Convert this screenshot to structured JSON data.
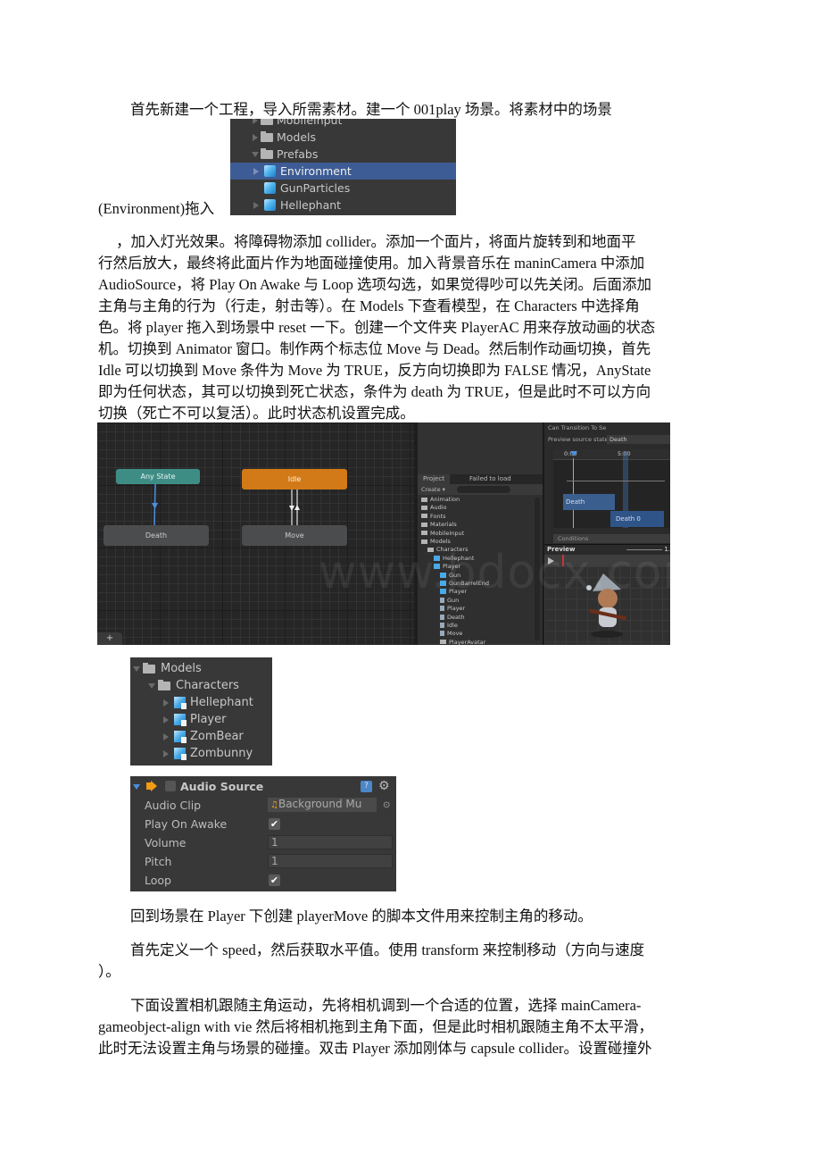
{
  "paragraphs": {
    "p1_line1": "首先新建一个工程，导入所需素材。建一个 001play 场景。将素材中的场景",
    "p1_line2_prefix": "(Environment)拖入",
    "p2_lines": [
      "，加入灯光效果。将障碍物添加 collider。添加一个面片，将面片旋转到和地面平",
      "行然后放大，最终将此面片作为地面碰撞使用。加入背景音乐在 maninCamera 中添加",
      "AudioSource，将 Play On Awake 与 Loop 选项勾选，如果觉得吵可以先关闭。后面添加",
      "主角与主角的行为（行走，射击等）。在 Models 下查看模型，在 Characters 中选择角",
      "色。将 player 拖入到场景中 reset 一下。创建一个文件夹 PlayerAC 用来存放动画的状态",
      "机。切换到 Animator 窗口。制作两个标志位 Move 与 Dead。然后制作动画切换，首先",
      "Idle 可以切换到 Move 条件为 Move 为 TRUE，反方向切换即为 FALSE 情况，AnyState",
      "即为任何状态，其可以切换到死亡状态，条件为 death 为 TRUE，但是此时不可以方向",
      "切换（死亡不可以复活）。此时状态机设置完成。"
    ],
    "p3": "回到场景在 Player 下创建 playerMove 的脚本文件用来控制主角的移动。",
    "p4_lines": [
      "首先定义一个 speed，然后获取水平值。使用 transform 来控制移动（方向与速度",
      "）。"
    ],
    "p5_lines": [
      "下面设置相机跟随主角运动，先将相机调到一个合适的位置，选择 mainCamera-",
      "gameobject-align with vie 然后将相机拖到主角下面，但是此时相机跟随主角不太平滑，",
      "此时无法设置主角与场景的碰撞。双击 Player 添加刚体与 capsule collider。设置碰撞外"
    ]
  },
  "prefabs_panel": {
    "items": [
      {
        "label": "MobileInput",
        "type": "folder",
        "expanded": false
      },
      {
        "label": "Models",
        "type": "folder",
        "expanded": false
      },
      {
        "label": "Prefabs",
        "type": "folder",
        "expanded": true
      },
      {
        "label": "Environment",
        "type": "prefab",
        "selected": true,
        "has_children": true
      },
      {
        "label": "GunParticles",
        "type": "prefab",
        "has_children": false
      },
      {
        "label": "Hellephant",
        "type": "prefab",
        "has_children": true
      }
    ]
  },
  "animator": {
    "states": {
      "any_state": "Any State",
      "idle": "Idle",
      "death": "Death",
      "move": "Move"
    },
    "add_button": "+",
    "watermark": "www.bdocx.com",
    "colors": {
      "any_state": "#3e8d85",
      "idle": "#d27a17",
      "default": "#4b4c4e",
      "transition": "#4a90e2"
    },
    "project": {
      "tabs": [
        "Project",
        "Failed to load"
      ],
      "create_label": "Create ▾",
      "items": [
        {
          "label": "Animation",
          "depth": 0,
          "type": "folder"
        },
        {
          "label": "Audio",
          "depth": 0,
          "type": "folder"
        },
        {
          "label": "Fonts",
          "depth": 0,
          "type": "folder"
        },
        {
          "label": "Materials",
          "depth": 0,
          "type": "folder"
        },
        {
          "label": "MobileInput",
          "depth": 0,
          "type": "folder"
        },
        {
          "label": "Models",
          "depth": 0,
          "type": "folder"
        },
        {
          "label": "Characters",
          "depth": 1,
          "type": "folder"
        },
        {
          "label": "Hellephant",
          "depth": 2,
          "type": "model"
        },
        {
          "label": "Player",
          "depth": 2,
          "type": "model"
        },
        {
          "label": "Gun",
          "depth": 3,
          "type": "model"
        },
        {
          "label": "GunBarrelEnd",
          "depth": 3,
          "type": "model"
        },
        {
          "label": "Player",
          "depth": 3,
          "type": "model"
        },
        {
          "label": "Gun",
          "depth": 3,
          "type": "mesh"
        },
        {
          "label": "Player",
          "depth": 3,
          "type": "mesh"
        },
        {
          "label": "Death",
          "depth": 3,
          "type": "anim"
        },
        {
          "label": "Idle",
          "depth": 3,
          "type": "anim"
        },
        {
          "label": "Move",
          "depth": 3,
          "type": "anim"
        },
        {
          "label": "PlayerAvatar",
          "depth": 3,
          "type": "avatar"
        }
      ]
    },
    "inspector": {
      "can_transition_label": "Can Transition To Se",
      "preview_source_label": "Preview source state",
      "preview_source_value": "Death",
      "timeline_start": "0:00",
      "timeline_end": "5:00",
      "bar_death": "Death",
      "bar_death0": "Death 0",
      "conditions_label": "Conditions",
      "preview_label": "Preview",
      "speed_value": "1."
    }
  },
  "models_panel": {
    "items": [
      {
        "label": "Models",
        "type": "folder",
        "depth": 0
      },
      {
        "label": "Characters",
        "type": "folder",
        "depth": 1
      },
      {
        "label": "Hellephant",
        "type": "model",
        "depth": 2
      },
      {
        "label": "Player",
        "type": "model",
        "depth": 2
      },
      {
        "label": "ZomBear",
        "type": "model",
        "depth": 2
      },
      {
        "label": "Zombunny",
        "type": "model",
        "depth": 2
      }
    ]
  },
  "audio_source": {
    "title": "Audio Source",
    "fields": [
      {
        "label": "Audio Clip",
        "type": "object",
        "value": "Background Mu"
      },
      {
        "label": "Play On Awake",
        "type": "checkbox",
        "value": "✔"
      },
      {
        "label": "Volume",
        "type": "number",
        "value": "1"
      },
      {
        "label": "Pitch",
        "type": "number",
        "value": "1"
      },
      {
        "label": "Loop",
        "type": "checkbox",
        "value": "✔"
      }
    ]
  }
}
